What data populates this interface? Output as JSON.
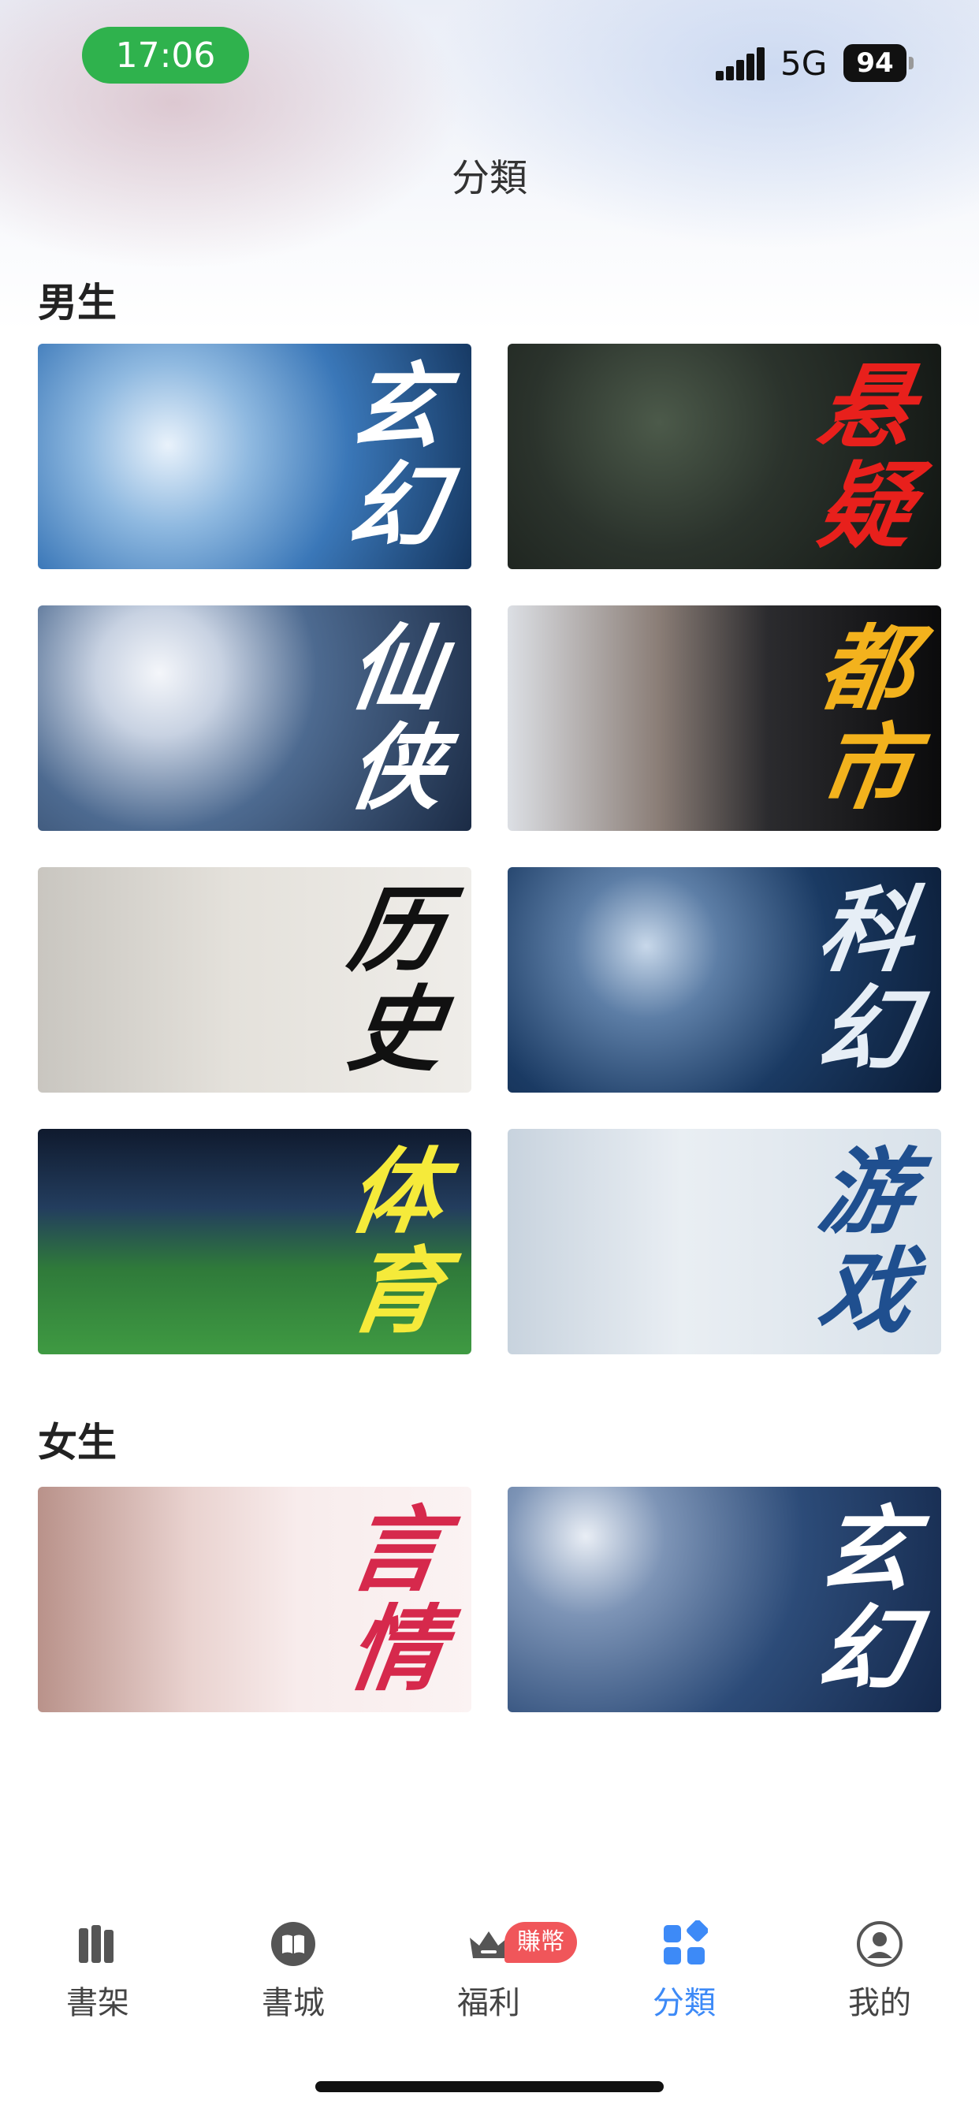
{
  "status_bar": {
    "time": "17:06",
    "network": "5G",
    "battery": "94"
  },
  "page": {
    "title": "分類"
  },
  "sections": [
    {
      "title": "男生",
      "cards": [
        {
          "label": [
            "玄",
            "幻"
          ],
          "label_color": "#ffffff"
        },
        {
          "label": [
            "悬",
            "疑"
          ],
          "label_color": "#e8201c"
        },
        {
          "label": [
            "仙",
            "侠"
          ],
          "label_color": "#ffffff"
        },
        {
          "label": [
            "都",
            "市"
          ],
          "label_color": "#f3b21d"
        },
        {
          "label": [
            "历",
            "史"
          ],
          "label_color": "#111111"
        },
        {
          "label": [
            "科",
            "幻"
          ],
          "label_color": "#e6eef6"
        },
        {
          "label": [
            "体",
            "育"
          ],
          "label_color": "#f5ea3a"
        },
        {
          "label": [
            "游",
            "戏"
          ],
          "label_color": "#1f4f8f"
        }
      ]
    },
    {
      "title": "女生",
      "cards": [
        {
          "label": [
            "言",
            "情"
          ],
          "label_color": "#d6294c"
        },
        {
          "label": [
            "玄",
            "幻"
          ],
          "label_color": "#ffffff"
        }
      ]
    }
  ],
  "tab_bar": {
    "items": [
      {
        "label": "書架",
        "icon": "bookshelf-icon"
      },
      {
        "label": "書城",
        "icon": "book-store-icon"
      },
      {
        "label": "福利",
        "icon": "crown-icon"
      },
      {
        "label": "分類",
        "icon": "category-icon"
      },
      {
        "label": "我的",
        "icon": "profile-icon"
      }
    ],
    "active": "分類",
    "badge": "賺幣"
  },
  "colors": {
    "accent": "#3d8af7",
    "status_pill": "#2fb24d",
    "badge": "#f0565a"
  }
}
